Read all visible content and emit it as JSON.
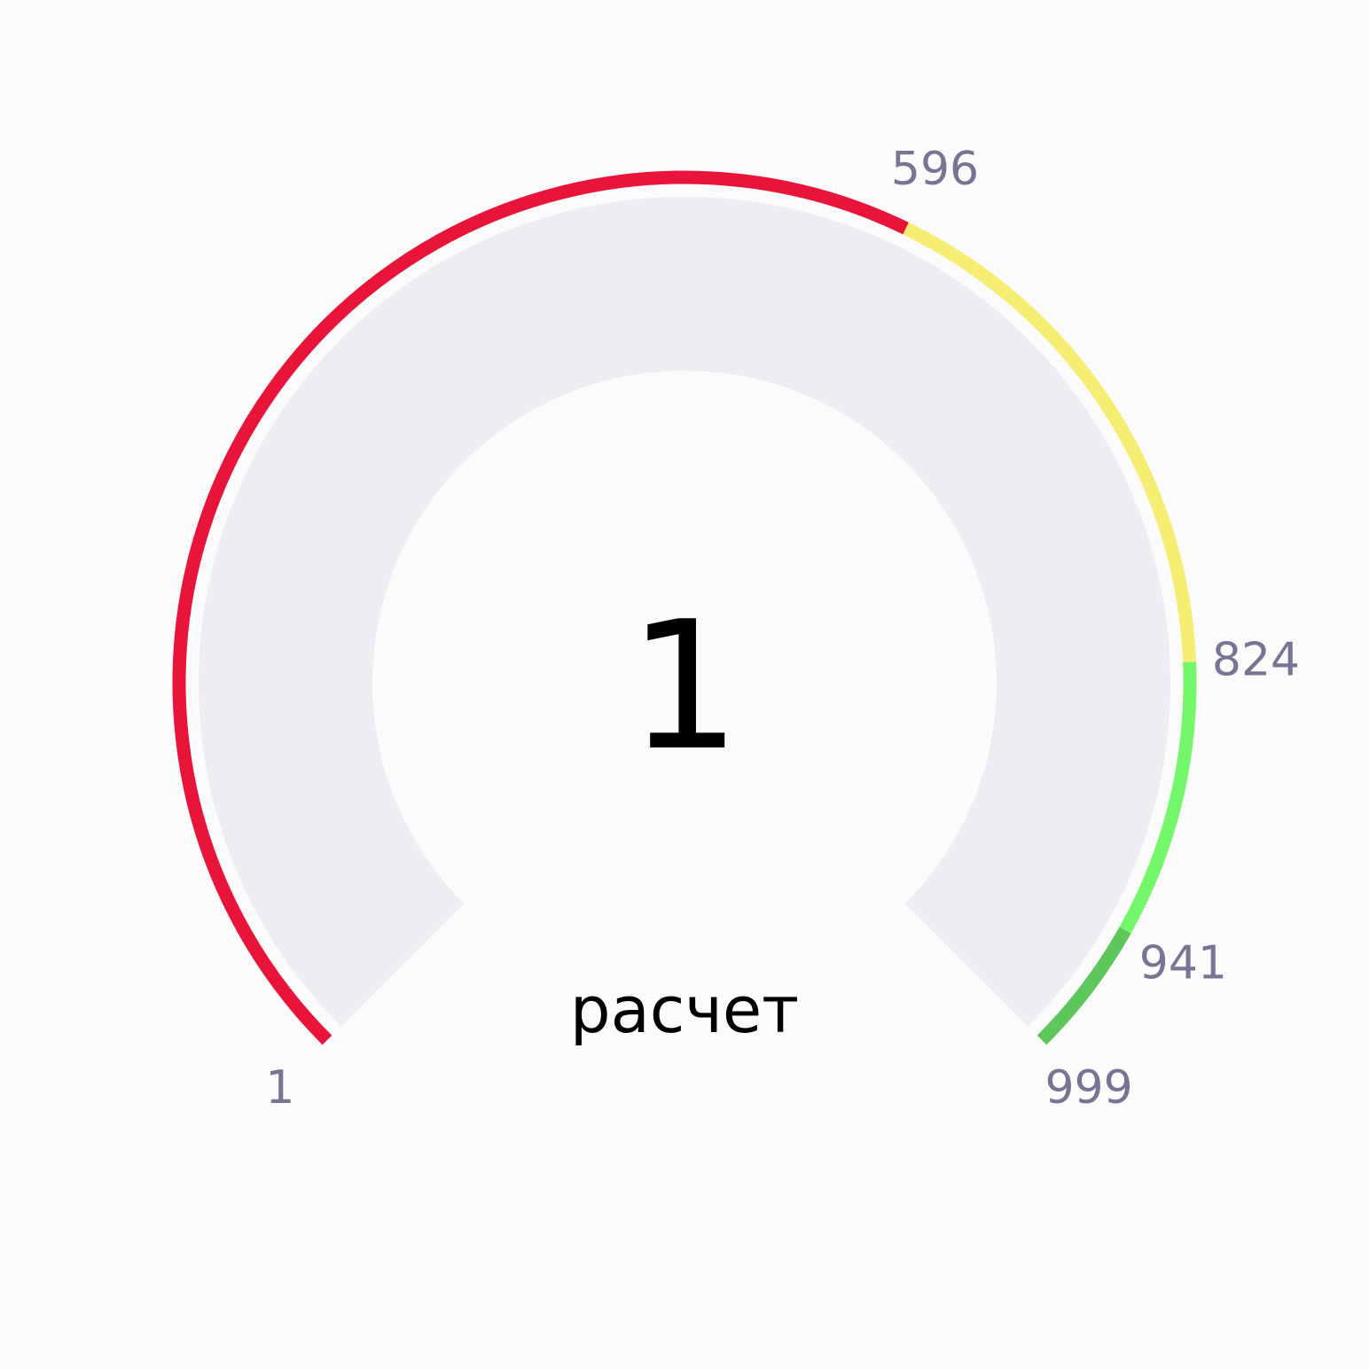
{
  "chart_data": {
    "type": "gauge",
    "value": 1,
    "min": 1,
    "max": 999,
    "caption": "расчет",
    "bands": [
      {
        "from": 1,
        "to": 596,
        "color": "#e8143a"
      },
      {
        "from": 596,
        "to": 824,
        "color": "#f6ee72"
      },
      {
        "from": 824,
        "to": 941,
        "color": "#74f76a"
      },
      {
        "from": 941,
        "to": 999,
        "color": "#5ec75b"
      }
    ],
    "tick_labels": [
      "1",
      "596",
      "824",
      "941",
      "999"
    ],
    "colors": {
      "track": "#ededf3",
      "tick_text": "#767694",
      "value_text": "#000000",
      "background": "#fbfbfc"
    }
  }
}
